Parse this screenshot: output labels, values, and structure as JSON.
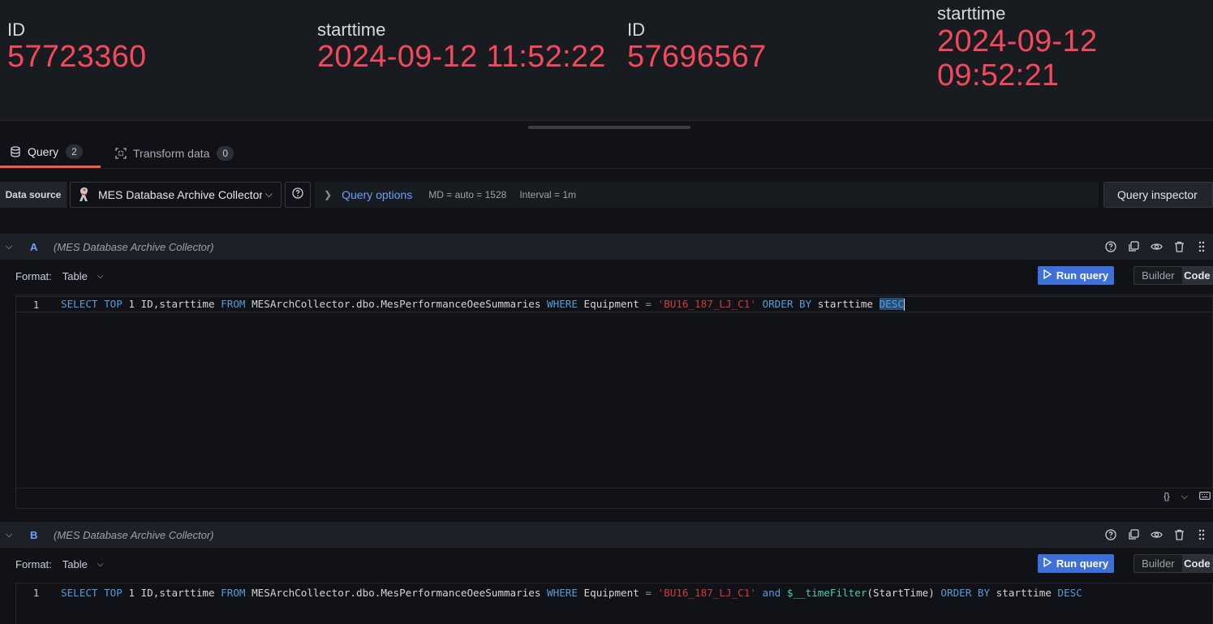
{
  "stats": [
    {
      "label": "ID",
      "value": "57723360"
    },
    {
      "label": "starttime",
      "value": "2024-09-12 11:52:22"
    },
    {
      "label": "ID",
      "value": "57696567"
    },
    {
      "label": "starttime",
      "value": "2024-09-12 09:52:21"
    }
  ],
  "tabs": [
    {
      "label": "Query",
      "count": "2",
      "icon": "database-icon"
    },
    {
      "label": "Transform data",
      "count": "0",
      "icon": "transform-icon"
    }
  ],
  "toolbar": {
    "datasource_label": "Data source",
    "datasource_value": "MES Database Archive Collector",
    "query_options_label": "Query options",
    "md": "MD = auto = 1528",
    "interval": "Interval = 1m",
    "inspector_label": "Query inspector"
  },
  "queries": [
    {
      "ref": "A",
      "datasource": "(MES Database Archive Collector)",
      "format_label": "Format:",
      "format_value": "Table",
      "run_label": "Run query",
      "builder_label": "Builder",
      "code_label": "Code",
      "line_no": "1",
      "sql": {
        "t1": "SELECT",
        "t2": "TOP",
        "t3": " 1 ID,starttime ",
        "t4": "FROM",
        "t5": " MESArchCollector.dbo.MesPerformanceOeeSummaries ",
        "t6": "WHERE",
        "t7": " Equipment ",
        "t8": "=",
        "t9": "'BU16_187_LJ_C1'",
        "t10": "ORDER",
        "t11": "BY",
        "t12": " starttime ",
        "t13": "DESC"
      }
    },
    {
      "ref": "B",
      "datasource": "(MES Database Archive Collector)",
      "format_label": "Format:",
      "format_value": "Table",
      "run_label": "Run query",
      "builder_label": "Builder",
      "code_label": "Code",
      "line_no": "1",
      "sql": {
        "t1": "SELECT",
        "t2": "TOP",
        "t3": " 1 ID,starttime ",
        "t4": "FROM",
        "t5": " MESArchCollector.dbo.MesPerformanceOeeSummaries ",
        "t6": "WHERE",
        "t7": " Equipment ",
        "t8": "=",
        "t9": "'BU16_187_LJ_C1'",
        "t10": "and",
        "t11": "$__timeFilter",
        "t12": "(StartTime) ",
        "t13": "ORDER",
        "t14": "BY",
        "t15": " starttime ",
        "t16": "DESC"
      }
    }
  ],
  "editor_footer": {
    "format_icon": "{}"
  },
  "colors": {
    "stat_value": "#f2495c",
    "accent": "#3d71d9",
    "active_tab": "#f55f3e",
    "link": "#6e9fff"
  }
}
